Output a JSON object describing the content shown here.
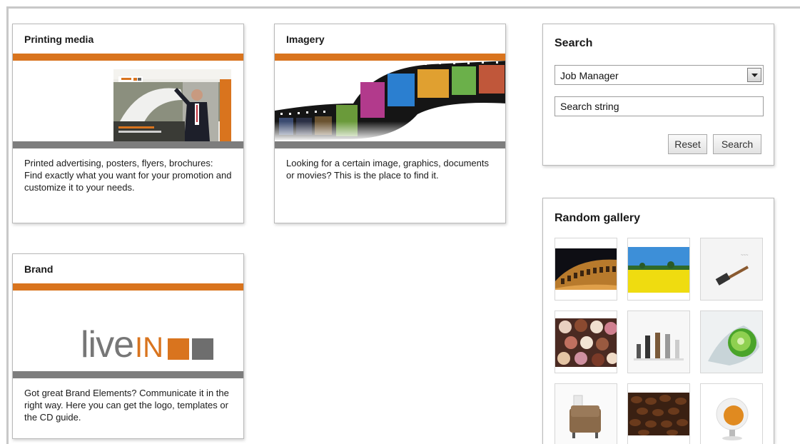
{
  "tiles": {
    "printing": {
      "title": "Printing media",
      "description": "Printed advertising, posters, flyers, brochures: Find exactly what you want for your promotion and customize it to your needs."
    },
    "imagery": {
      "title": "Imagery",
      "description": "Looking for a certain image, graphics, documents or movies? This is the place to find it."
    },
    "brand": {
      "title": "Brand",
      "description": "Got great Brand Elements? Communicate it in the right way. Here you can get the logo, templates or the CD guide.",
      "logo_text_live": "live",
      "logo_text_in": "IN"
    }
  },
  "search": {
    "title": "Search",
    "selected_option": "Job Manager",
    "input_value": "Search string",
    "reset_label": "Reset",
    "search_label": "Search"
  },
  "gallery": {
    "title": "Random gallery",
    "items": [
      {
        "name": "colosseum-thumb"
      },
      {
        "name": "yellow-field-thumb"
      },
      {
        "name": "hammer-thumb"
      },
      {
        "name": "cupcakes-thumb"
      },
      {
        "name": "chairs-thumb"
      },
      {
        "name": "lime-splash-thumb"
      },
      {
        "name": "armchair-thumb"
      },
      {
        "name": "coffee-beans-thumb"
      },
      {
        "name": "egg-chair-thumb"
      }
    ]
  },
  "colors": {
    "accent_orange": "#d9741e",
    "bar_grey": "#7d7d7d"
  }
}
